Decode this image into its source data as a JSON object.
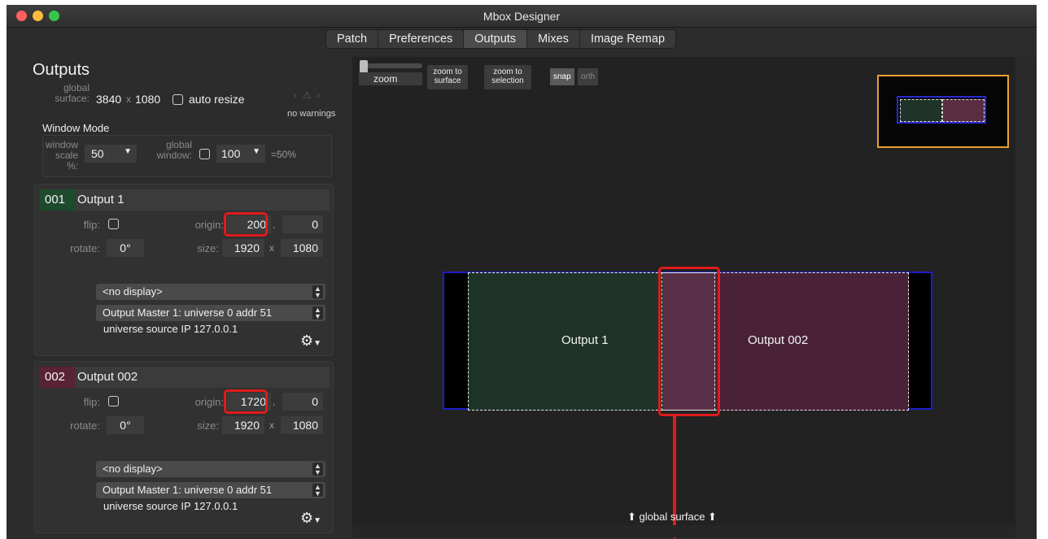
{
  "window": {
    "title": "Mbox Designer"
  },
  "tabs": [
    {
      "label": "Patch",
      "active": false
    },
    {
      "label": "Preferences",
      "active": false
    },
    {
      "label": "Outputs",
      "active": true
    },
    {
      "label": "Mixes",
      "active": false
    },
    {
      "label": "Image Remap",
      "active": false
    }
  ],
  "outputs_panel": {
    "title": "Outputs",
    "global_surface_label_1": "global",
    "global_surface_label_2": "surface:",
    "global_width": "3840",
    "times": "x",
    "global_height": "1080",
    "auto_resize_label": "auto resize",
    "warnings": "no warnings",
    "window_mode_label": "Window Mode",
    "window_scale_label_1": "window",
    "window_scale_label_2": "scale %:",
    "window_scale_value": "50",
    "global_window_label_1": "global",
    "global_window_label_2": "window:",
    "global_window_value": "100",
    "global_window_result": "=50%"
  },
  "outputs": [
    {
      "number": "001",
      "name": "Output 1",
      "badge_color": "#1e4a2e",
      "flip_label": "flip:",
      "origin_label": "origin:",
      "origin_x": "200",
      "origin_y": "0",
      "rotate_label": "rotate:",
      "rotate_value": "0°",
      "size_label": "size:",
      "size_w": "1920",
      "size_h": "1080",
      "display_select": "<no display>",
      "master_select": "Output Master 1: universe 0 addr 51",
      "source_ip": "universe source IP 127.0.0.1"
    },
    {
      "number": "002",
      "name": "Output 002",
      "badge_color": "#5a2236",
      "flip_label": "flip:",
      "origin_label": "origin:",
      "origin_x": "1720",
      "origin_y": "0",
      "rotate_label": "rotate:",
      "rotate_value": "0°",
      "size_label": "size:",
      "size_w": "1920",
      "size_h": "1080",
      "display_select": "<no display>",
      "master_select": "Output Master 1: universe 0 addr 51",
      "source_ip": "universe source IP 127.0.0.1"
    }
  ],
  "canvas": {
    "zoom_label": "zoom",
    "zoom_to_surface": [
      "zoom to",
      "surface"
    ],
    "zoom_to_selection": [
      "zoom to",
      "selection"
    ],
    "snap": "snap",
    "orth": "orth",
    "output1_label": "Output 1",
    "output2_label": "Output 002",
    "global_surface_label": "⬆ global surface ⬆",
    "output1_color": "#1f3428",
    "output2_color": "#4a2238",
    "overlap_color": "#5a3048"
  }
}
